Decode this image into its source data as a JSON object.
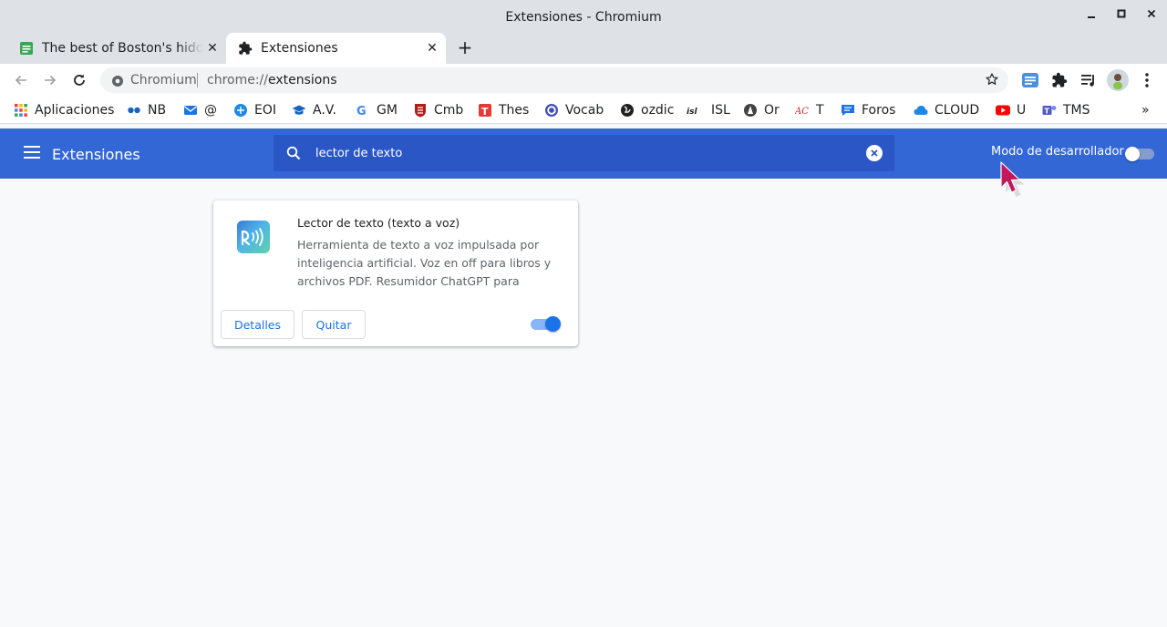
{
  "window": {
    "title": "Extensiones - Chromium"
  },
  "tabs": [
    {
      "label": "The best of Boston's hidden",
      "active": false
    },
    {
      "label": "Extensiones",
      "active": true
    }
  ],
  "address_bar": {
    "origin_label": "Chromium",
    "url_scheme": "chrome://",
    "url_path": "extensions"
  },
  "bookmarks": [
    {
      "label": "Aplicaciones",
      "icon": "apps-grid-icon"
    },
    {
      "label": "NB",
      "icon": "nb-icon"
    },
    {
      "label": "@",
      "icon": "mail-icon"
    },
    {
      "label": "EOI",
      "icon": "eoi-icon"
    },
    {
      "label": "A.V.",
      "icon": "graduation-cap-icon"
    },
    {
      "label": "GM",
      "icon": "google-icon"
    },
    {
      "label": "Cmb",
      "icon": "cambridge-icon"
    },
    {
      "label": "Thes",
      "icon": "thesaurus-icon"
    },
    {
      "label": "Vocab",
      "icon": "vocab-icon"
    },
    {
      "label": "ozdic",
      "icon": "globe-icon"
    },
    {
      "label": "ISL",
      "icon": "isl-icon"
    },
    {
      "label": "Or",
      "icon": "or-icon"
    },
    {
      "label": "T",
      "icon": "ac-icon"
    },
    {
      "label": "Foros",
      "icon": "forum-icon"
    },
    {
      "label": "CLOUD",
      "icon": "cloud-icon"
    },
    {
      "label": "U",
      "icon": "youtube-icon"
    },
    {
      "label": "TMS",
      "icon": "teams-icon"
    }
  ],
  "extensions_page": {
    "title": "Extensiones",
    "search_value": "lector de texto",
    "dev_mode_label": "Modo de desarrollador",
    "dev_mode_on": false
  },
  "extension_card": {
    "name": "Lector de texto (texto a voz)",
    "description": "Herramienta de texto a voz impulsada por inteligencia artificial. Voz en off para libros y archivos PDF. Resumidor ChatGPT para cualquier",
    "details_label": "Detalles",
    "remove_label": "Quitar",
    "enabled": true
  },
  "colors": {
    "header_blue": "#3367d6",
    "search_blue": "#2a56c6",
    "accent": "#1a73e8",
    "cursor": "#c2185b"
  }
}
